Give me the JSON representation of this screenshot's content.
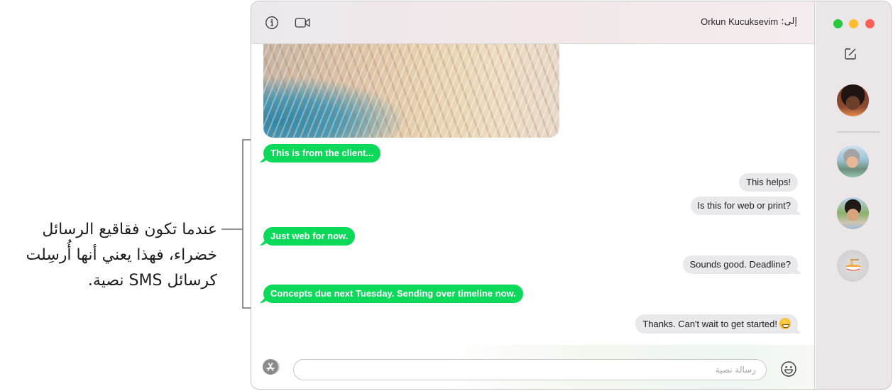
{
  "callout": {
    "text": "عندما تكون فقاقيع الرسائل خضراء، فهذا يعني أنها أُرسِلت كرسائل SMS نصية."
  },
  "header": {
    "to_label": "إلى:",
    "recipient_name": "Orkun Kucuksevim",
    "info_icon": "info-circle-icon",
    "video_icon": "video-camera-icon"
  },
  "messages": [
    {
      "type": "photo",
      "direction": "incoming",
      "description": "close-up of blonde hair"
    },
    {
      "type": "sms",
      "direction": "outgoing",
      "text": "This is from the client..."
    },
    {
      "type": "received",
      "direction": "incoming",
      "text": "This helps!"
    },
    {
      "type": "received",
      "direction": "incoming",
      "text": "Is this for web or print?"
    },
    {
      "type": "sms",
      "direction": "outgoing",
      "text": "Just web for now."
    },
    {
      "type": "received",
      "direction": "incoming",
      "text": "Sounds good. Deadline?"
    },
    {
      "type": "sms",
      "direction": "outgoing",
      "text": "Concepts due next Tuesday. Sending over timeline now."
    },
    {
      "type": "received",
      "direction": "incoming",
      "text": "Thanks. Can't wait to get started!",
      "emoji": "grinning-face"
    }
  ],
  "compose": {
    "input_value": "",
    "placeholder": "رسالة نصية",
    "apps_icon": "app-store-icon",
    "emoji_icon": "smiley-icon"
  },
  "sidebar": {
    "traffic_lights": {
      "green": "#28c840",
      "yellow": "#febc2e",
      "red": "#ff5f57"
    },
    "compose_icon": "compose-icon",
    "conversations": [
      {
        "kind": "photo-avatar",
        "pinned": true
      },
      {
        "kind": "photo-avatar",
        "pinned": false
      },
      {
        "kind": "photo-avatar",
        "pinned": false
      },
      {
        "kind": "emoji-avatar",
        "emoji": "noodle-bowl",
        "pinned": false
      }
    ]
  },
  "colors": {
    "sms_bubble": "#0ad95a",
    "received_bubble": "#e9e9eb",
    "callout_line": "#8e8e93"
  }
}
